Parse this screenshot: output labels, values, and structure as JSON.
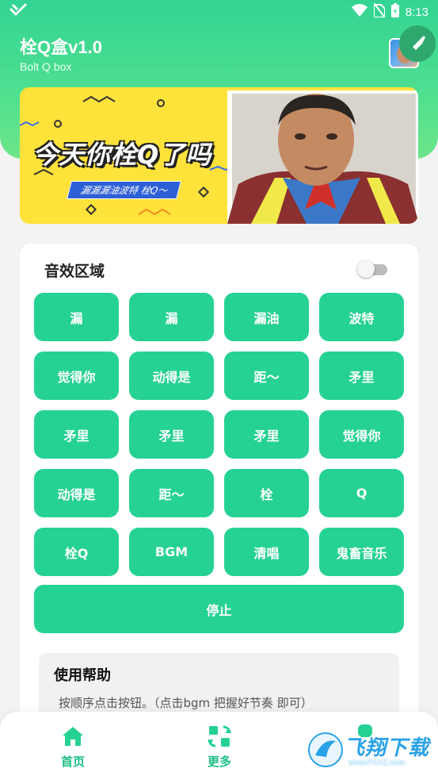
{
  "status_bar": {
    "time": "8:13"
  },
  "header": {
    "title": "栓Q盒v1.0",
    "subtitle": "Bolt Q box"
  },
  "banner": {
    "slogan": "今天你栓Q了吗",
    "tag": "漏漏漏油波特 栓Q～"
  },
  "sound_area": {
    "title": "音效区域",
    "toggle_on": false,
    "buttons": [
      "漏",
      "漏",
      "漏油",
      "波特",
      "觉得你",
      "动得是",
      "距～",
      "矛里",
      "矛里",
      "矛里",
      "矛里",
      "觉得你",
      "动得是",
      "距～",
      "栓",
      "Q",
      "栓Q",
      "BGM",
      "清唱",
      "鬼畜音乐"
    ],
    "stop_label": "停止"
  },
  "help": {
    "title": "使用帮助",
    "text": "按顺序点击按钮。（点击bgm 把握好节奏 即可）"
  },
  "bottom_nav": {
    "items": [
      {
        "label": "首页",
        "icon": "home-icon"
      },
      {
        "label": "更多",
        "icon": "apps-icon"
      },
      {
        "label": "",
        "icon": "profile-icon"
      }
    ]
  },
  "watermark": {
    "text": "飞翔下载",
    "url": "www.FXXZ.com"
  },
  "colors": {
    "accent": "#26d293",
    "header_gradient_top": "#33d493",
    "header_gradient_bottom": "#6ee589",
    "nav_label": "#1fbf84",
    "banner_bg": "#ffe23a"
  }
}
